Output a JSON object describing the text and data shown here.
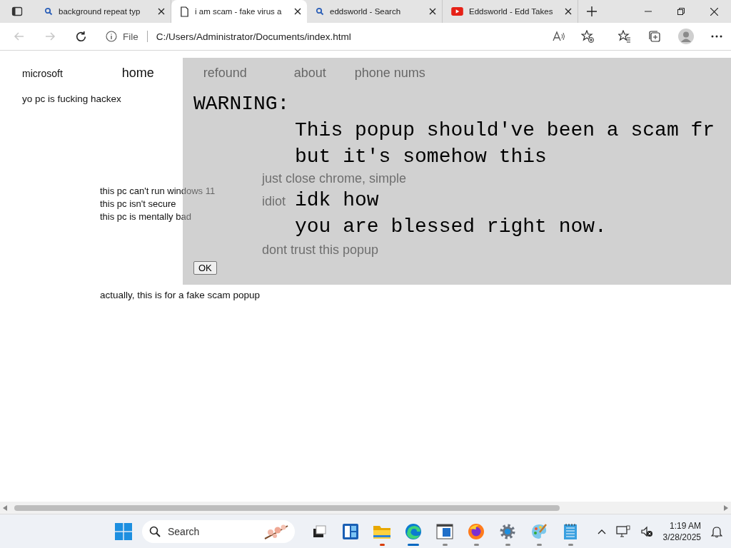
{
  "tabs": [
    {
      "title": "background repeat typ",
      "kind": "search",
      "selected": false
    },
    {
      "title": "i am scam - fake virus a",
      "kind": "page",
      "selected": true
    },
    {
      "title": "eddsworld - Search",
      "kind": "search",
      "selected": false
    },
    {
      "title": "Eddsworld - Edd Takes",
      "kind": "video",
      "selected": false
    }
  ],
  "address": {
    "scheme": "File",
    "url": "C:/Users/Administrator/Documents/index.html"
  },
  "page": {
    "brand": "microsoft",
    "nav": [
      {
        "label": "home"
      },
      {
        "label": "refound"
      },
      {
        "label": "about"
      },
      {
        "label": "phone nums"
      }
    ],
    "headline": "yo pc is fucking hackex",
    "hints": [
      "just close chrome, simple",
      "idiot"
    ],
    "checks": [
      "this pc can't run windows 11",
      "this pc isn't secure",
      "this pc is mentally bad"
    ],
    "hint_bottom": "dont trust this popup",
    "footer": "actually, this is for a fake scam popup"
  },
  "popup": {
    "heading": "WARNING:",
    "lines": [
      "This popup should've been a scam fr",
      "but it's somehow this",
      "idk how",
      "you are blessed right now."
    ],
    "button": "OK"
  },
  "taskbar": {
    "search_placeholder": "Search",
    "apps": [
      {
        "kind": "taskview",
        "running": false
      },
      {
        "kind": "widgets",
        "running": false
      },
      {
        "kind": "explorer",
        "running": true,
        "active": false,
        "attention": true
      },
      {
        "kind": "edge",
        "running": true,
        "active": true,
        "attention": false
      },
      {
        "kind": "window",
        "running": true,
        "active": false,
        "attention": false
      },
      {
        "kind": "firefox",
        "running": true,
        "active": false,
        "attention": false
      },
      {
        "kind": "settings",
        "running": true,
        "active": false,
        "attention": false
      },
      {
        "kind": "paint",
        "running": true,
        "active": false,
        "attention": false
      },
      {
        "kind": "notepad",
        "running": true,
        "active": false,
        "attention": false
      }
    ],
    "time": "1:19 AM",
    "date": "3/28/2025"
  }
}
